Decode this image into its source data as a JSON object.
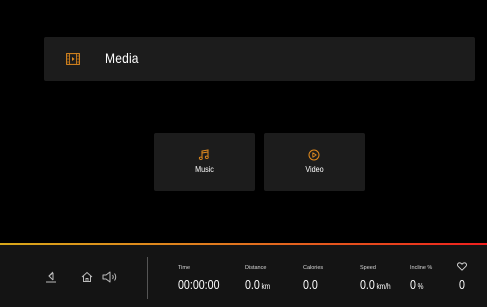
{
  "header": {
    "title": "Media",
    "icon": "media-player-icon"
  },
  "tiles": [
    {
      "label": "Music",
      "icon": "music-note-icon"
    },
    {
      "label": "Video",
      "icon": "play-circle-icon"
    }
  ],
  "colors": {
    "accent": "#e08a1e",
    "panel": "#1c1c1c",
    "background": "#000000",
    "bottom_bar": "#141414"
  },
  "nav": {
    "icons": [
      "back-icon",
      "home-icon",
      "volume-icon"
    ]
  },
  "metrics": {
    "time": {
      "label": "Time",
      "value": "00:00:00"
    },
    "distance": {
      "label": "Distance",
      "value": "0.0",
      "unit": "km"
    },
    "calories": {
      "label": "Calories",
      "value": "0.0"
    },
    "speed": {
      "label": "Speed",
      "value": "0.0",
      "unit": "km/h"
    },
    "incline": {
      "label": "Incline %",
      "value": "0",
      "unit": "%"
    },
    "heart_rate": {
      "icon": "heart-icon",
      "value": "0"
    }
  }
}
